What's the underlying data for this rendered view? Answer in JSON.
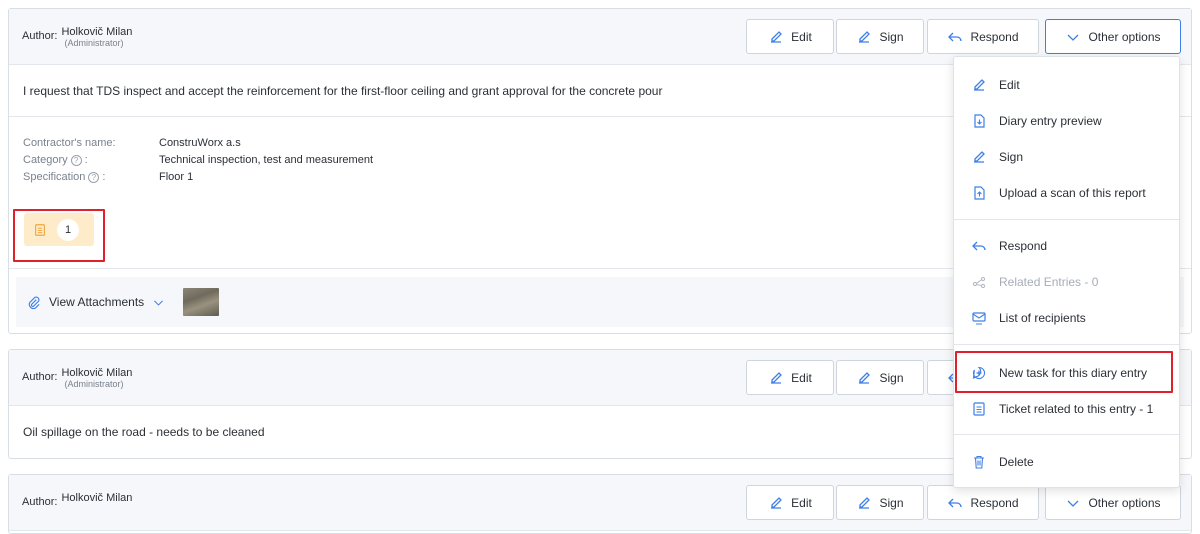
{
  "entries": [
    {
      "author_label": "Author:",
      "author_name": "Holkovič Milan",
      "author_role": "(Administrator)",
      "text": "I request that TDS inspect and accept the reinforcement for the first-floor ceiling and grant approval for the concrete pour",
      "details": [
        {
          "label": "Contractor's name:",
          "value": "ConstruWorx a.s",
          "help": false
        },
        {
          "label": "Category",
          "value": "Technical inspection, test and measurement",
          "help": true
        },
        {
          "label": "Specification",
          "value": "Floor 1",
          "help": true
        }
      ],
      "ticket_count": "1",
      "attachments_label": "View Attachments"
    },
    {
      "author_label": "Author:",
      "author_name": "Holkovič Milan",
      "author_role": "(Administrator)",
      "text": "Oil spillage on the road - needs to be cleaned"
    },
    {
      "author_label": "Author:",
      "author_name": "Holkovič Milan"
    }
  ],
  "buttons": {
    "edit": "Edit",
    "sign": "Sign",
    "respond": "Respond",
    "other_options": "Other options"
  },
  "help_mark": "?",
  "detail_colon": ":",
  "menu": {
    "items": [
      {
        "label": "Edit",
        "icon": "edit-icon"
      },
      {
        "label": "Diary entry preview",
        "icon": "file-download-icon"
      },
      {
        "label": "Sign",
        "icon": "sign-icon"
      },
      {
        "label": "Upload a scan of this report",
        "icon": "file-upload-icon"
      },
      {
        "label": "Respond",
        "icon": "reply-icon"
      },
      {
        "label": "Related Entries - 0",
        "icon": "related-icon"
      },
      {
        "label": "List of recipients",
        "icon": "recipients-icon"
      },
      {
        "label": "New task for this diary entry",
        "icon": "add-task-icon"
      },
      {
        "label": "Ticket related to this entry - 1",
        "icon": "ticket-icon"
      },
      {
        "label": "Delete",
        "icon": "trash-icon"
      }
    ]
  },
  "colors": {
    "accent": "#3e7fe6",
    "highlight": "#e0202a",
    "ticket_badge": "#fdebc9",
    "ticket_icon": "#f0a640"
  }
}
